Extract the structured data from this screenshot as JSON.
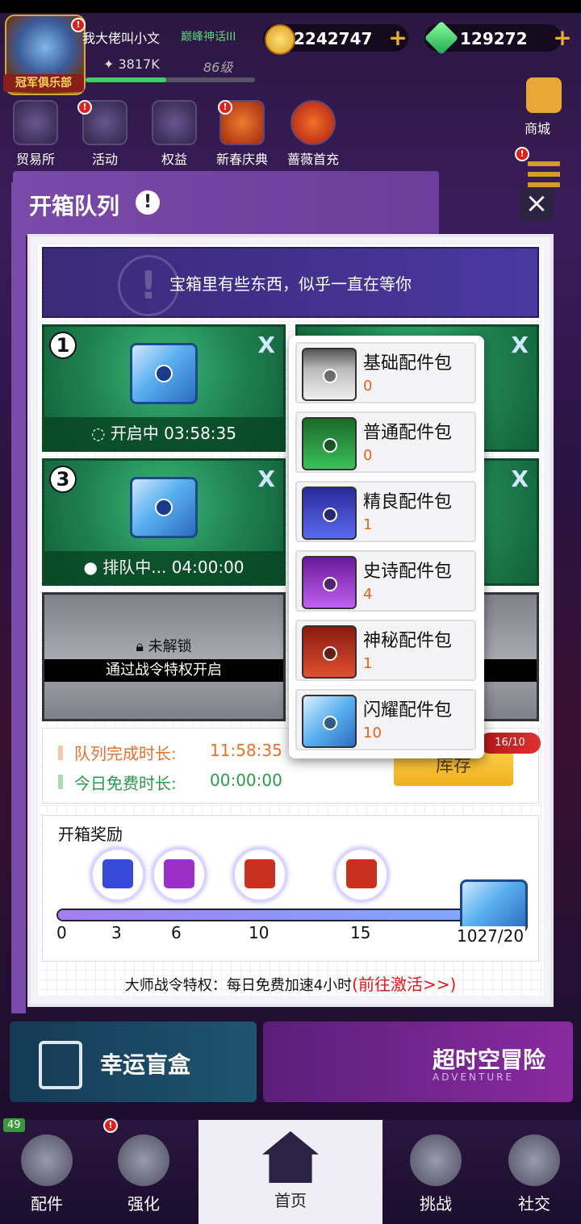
{
  "player": {
    "club": "冠军俱乐部",
    "name": "我大佬叫小文",
    "rank": "巅峰神话III",
    "power": "3817K",
    "level": "86级"
  },
  "resources": {
    "coins": "2242747",
    "gems": "129272",
    "plus": "+"
  },
  "top_menu": [
    {
      "label": "贸易所"
    },
    {
      "label": "活动"
    },
    {
      "label": "权益"
    },
    {
      "label": "新春庆典"
    },
    {
      "label": "蔷薇首充"
    }
  ],
  "shop_label": "商城",
  "dialog": {
    "title": "开箱队列",
    "close": "×",
    "hint": "宝箱里有些东西，似乎一直在等你",
    "slots": [
      {
        "num": "1",
        "status": "开启中 03:58:35"
      },
      {
        "num": "3",
        "status": "排队中... 04:00:00"
      }
    ],
    "remove": "X",
    "locked_label": "未解锁",
    "locked_hint": "通过战令特权开启",
    "queue_label": "队列完成时长:",
    "queue_value": "11:58:35",
    "free_label": "今日免费时长:",
    "free_value": "00:00:00",
    "stock_button": "库存",
    "capacity": "16/10",
    "rewards_title": "开箱奖励",
    "ticks": [
      "0",
      "3",
      "6",
      "10",
      "15"
    ],
    "progress_label": "1027/20",
    "progress": 0.9,
    "footer_text": "大师战令特权：每日免费加速4小时",
    "footer_link": "(前往激活>>)"
  },
  "packs": [
    {
      "name": "基础配件包",
      "count": "0",
      "color": "#9aa0aa"
    },
    {
      "name": "普通配件包",
      "count": "0",
      "color": "#2aa04a"
    },
    {
      "name": "精良配件包",
      "count": "1",
      "color": "#3a4ad8"
    },
    {
      "name": "史诗配件包",
      "count": "4",
      "color": "#9a30c8"
    },
    {
      "name": "神秘配件包",
      "count": "1",
      "color": "#c83020"
    },
    {
      "name": "闪耀配件包",
      "count": "10",
      "color": "#5ab0f0"
    }
  ],
  "banners": {
    "lucky_box": "幸运盲盒",
    "adventure": "超时空冒险",
    "adventure_sub": "ADVENTURE"
  },
  "nav": [
    {
      "label": "配件"
    },
    {
      "label": "强化"
    },
    {
      "label": "首页"
    },
    {
      "label": "挑战"
    },
    {
      "label": "社交"
    }
  ],
  "badge_count": "49"
}
